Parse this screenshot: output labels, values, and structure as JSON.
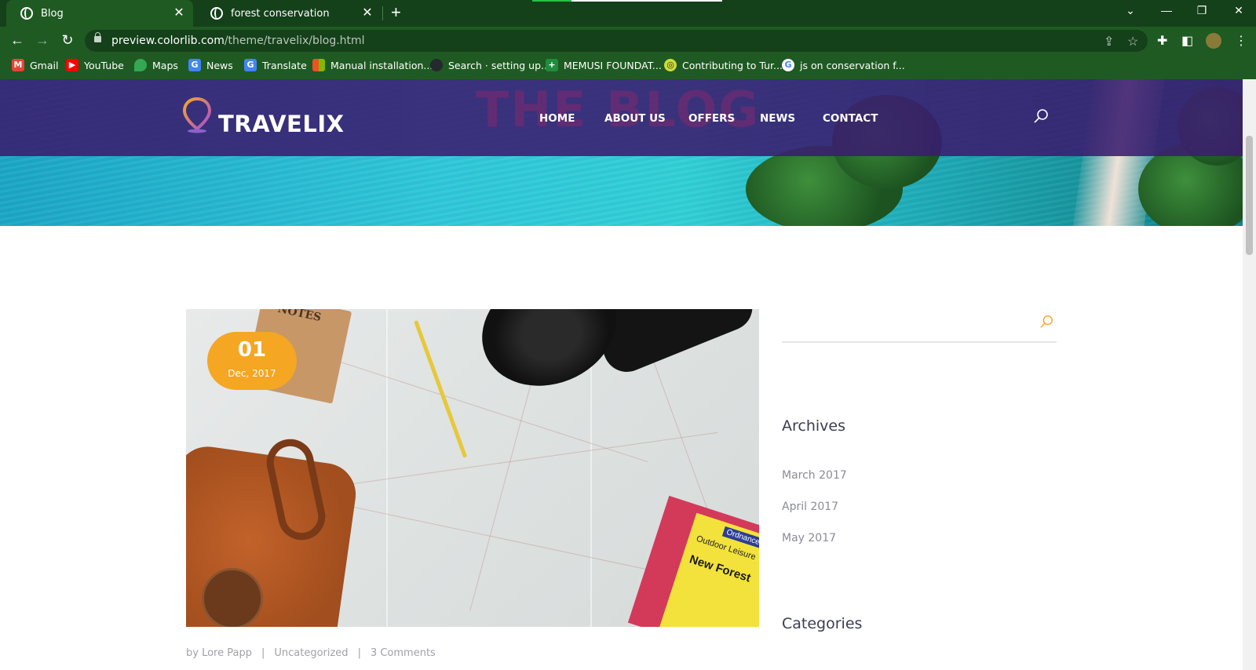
{
  "browser": {
    "tabs": [
      {
        "title": "Blog",
        "active": true
      },
      {
        "title": "forest conservation",
        "active": false
      }
    ],
    "url_host": "preview.colorlib.com",
    "url_path": "/theme/travelix/blog.html",
    "bookmarks": [
      {
        "label": "Gmail",
        "icon": "gmail-icon",
        "color": "#ea4335"
      },
      {
        "label": "YouTube",
        "icon": "youtube-icon",
        "color": "#ff0000"
      },
      {
        "label": "Maps",
        "icon": "maps-icon",
        "color": "#34a853"
      },
      {
        "label": "News",
        "icon": "news-icon",
        "color": "#4285f4"
      },
      {
        "label": "Translate",
        "icon": "translate-icon",
        "color": "#4285f4"
      },
      {
        "label": "Manual installation...",
        "icon": "microsoft-icon",
        "color": "#f25022"
      },
      {
        "label": "Search · setting up...",
        "icon": "github-icon",
        "color": "#24292e"
      },
      {
        "label": "MEMUSI FOUNDAT...",
        "icon": "memusi-icon",
        "color": "#1e8e3e"
      },
      {
        "label": "Contributing to Tur...",
        "icon": "turtle-icon",
        "color": "#cddc39"
      },
      {
        "label": "js on conservation f...",
        "icon": "google-icon",
        "color": "#4285f4"
      }
    ]
  },
  "site": {
    "logo": "TRAVELIX",
    "hero_title": "THE BLOG",
    "nav": [
      "HOME",
      "ABOUT US",
      "OFFERS",
      "NEWS",
      "CONTACT"
    ],
    "accent": "#f5a623",
    "header_color": "#3a1c6e"
  },
  "post": {
    "day": "01",
    "month_year": "Dec, 2017",
    "author": "by Lore Papp",
    "category": "Uncategorized",
    "comments": "3 Comments",
    "image_text": {
      "notebook": "NOTES",
      "map_title": "New Forest",
      "map_subtitle": "Outdoor Leisure",
      "map_brand": "Ordnance Survey"
    }
  },
  "sidebar": {
    "archives_title": "Archives",
    "archives": [
      "March 2017",
      "April 2017",
      "May 2017"
    ],
    "categories_title": "Categories"
  }
}
